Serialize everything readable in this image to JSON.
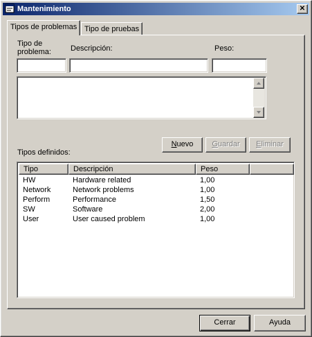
{
  "window": {
    "title": "Mantenimiento",
    "close_glyph": "✕"
  },
  "tabs": [
    {
      "label": "Tipos de problemas",
      "active": true
    },
    {
      "label": "Tipo de pruebas",
      "active": false
    }
  ],
  "form": {
    "tipo_label_line1": "Tipo de",
    "tipo_label_line2": "problema:",
    "descripcion_label": "Descripción:",
    "peso_label": "Peso:",
    "tipo_value": "",
    "descripcion_value": "",
    "peso_value": "",
    "notes_value": ""
  },
  "buttons": {
    "nuevo_first": "N",
    "nuevo_rest": "uevo",
    "guardar_first": "G",
    "guardar_rest": "uardar",
    "eliminar_first": "E",
    "eliminar_rest": "liminar",
    "cerrar": "Cerrar",
    "ayuda": "Ayuda"
  },
  "list": {
    "title": "Tipos definidos:",
    "columns": [
      "Tipo",
      "Descripción",
      "Peso",
      ""
    ],
    "rows": [
      {
        "tipo": "HW",
        "descripcion": "Hardware related",
        "peso": "1,00"
      },
      {
        "tipo": "Network",
        "descripcion": "Network problems",
        "peso": "1,00"
      },
      {
        "tipo": "Perform",
        "descripcion": "Performance",
        "peso": "1,50"
      },
      {
        "tipo": "SW",
        "descripcion": "Software",
        "peso": "2,00"
      },
      {
        "tipo": "User",
        "descripcion": "User caused problem",
        "peso": "1,00"
      }
    ]
  },
  "icons": {
    "app": "form-window-icon",
    "scroll_up": "arrow-up-icon",
    "scroll_down": "arrow-down-icon"
  }
}
